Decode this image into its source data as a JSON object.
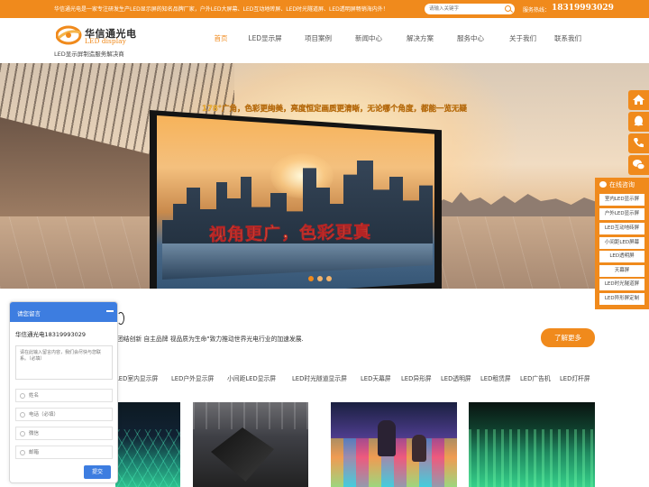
{
  "topbar": {
    "notice": "华信通光电是一家专注研发生产LED显示屏的知名品牌厂家，户外LED大屏幕、LED互动地砖屏、LED时光隧道屏、LED透明屏畅销海内外！",
    "search_placeholder": "请输入关键字",
    "hotline_label": "服务热线：",
    "hotline": "18319993029"
  },
  "logo": {
    "cn": "华信通光电",
    "en": "LED display",
    "slogan": "LED显示屏制造服务解决商"
  },
  "nav": {
    "items": [
      {
        "label": "首页"
      },
      {
        "label": "LED显示屏"
      },
      {
        "label": "项目案例"
      },
      {
        "label": "新闻中心"
      },
      {
        "label": "解决方案"
      },
      {
        "label": "服务中心"
      },
      {
        "label": "关于我们"
      },
      {
        "label": "联系我们"
      }
    ]
  },
  "banner": {
    "headline": "178°广角，色彩更绚美，亮度恒定画质更清晰，无论哪个角度，都能一览无疑",
    "screen_tagline": "视角更广，色彩更真"
  },
  "side_tools": {
    "icons": [
      "home-icon",
      "qq-icon",
      "phone-icon",
      "wechat-icon"
    ]
  },
  "consult": {
    "title": "在线咨询",
    "items": [
      {
        "label": "室内LED显示屏"
      },
      {
        "label": "户外LED显示屏"
      },
      {
        "label": "LED互动地砖屏"
      },
      {
        "label": "小间距LED屏幕"
      },
      {
        "label": "LED透明屏"
      },
      {
        "label": "天幕屏"
      },
      {
        "label": "LED时光隧道屏"
      },
      {
        "label": "LED异形屏定制"
      }
    ]
  },
  "about": {
    "text": "团结创新 自主品牌 视品质为生命\"致力推动世界光电行业的加速发展.",
    "button": "了解更多"
  },
  "tabs": [
    {
      "label": "LED室内显示屏"
    },
    {
      "label": "LED户外显示屏"
    },
    {
      "label": "小间距LED显示屏"
    },
    {
      "label": "LED时光隧道显示屏"
    },
    {
      "label": "LED天幕屏"
    },
    {
      "label": "LED异形屏"
    },
    {
      "label": "LED透明屏"
    },
    {
      "label": "LED租赁屏"
    },
    {
      "label": "LED广告机"
    },
    {
      "label": "LED灯杆屏"
    }
  ],
  "message": {
    "title": "请您留言",
    "company": "华信通光电18319993029",
    "content_placeholder": "请在此输入留言内容，我们会尽快与您联系。（必填）",
    "fields": [
      {
        "placeholder": "姓名"
      },
      {
        "placeholder": "电话（必填）"
      },
      {
        "placeholder": "微信"
      },
      {
        "placeholder": "邮箱"
      }
    ],
    "submit": "提交"
  },
  "colors": {
    "brand_orange": "#f08a1c",
    "widget_blue": "#3d7de0"
  }
}
